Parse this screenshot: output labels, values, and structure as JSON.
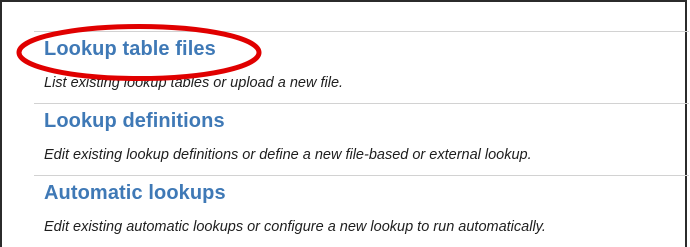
{
  "lookups_menu": {
    "items": [
      {
        "title": "Lookup table files",
        "description": "List existing lookup tables or upload a new file."
      },
      {
        "title": "Lookup definitions",
        "description": "Edit existing lookup definitions or define a new file-based or external lookup."
      },
      {
        "title": "Automatic lookups",
        "description": "Edit existing automatic lookups or configure a new lookup to run automatically."
      }
    ]
  },
  "annotation": {
    "highlight_color": "#e00000",
    "highlighted_item": "Lookup table files"
  }
}
